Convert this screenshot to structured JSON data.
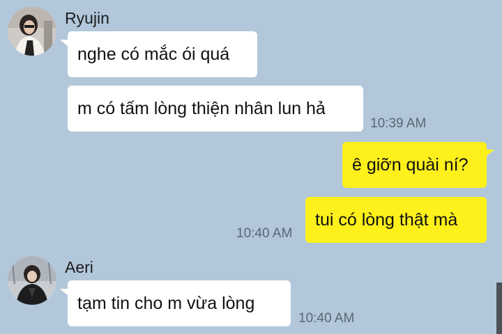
{
  "messages": [
    {
      "sender": "Ryujin",
      "text": "nghe có mắc ói quá",
      "direction": "incoming"
    },
    {
      "sender": "Ryujin",
      "text": "m có tấm lòng thiện nhân lun hả",
      "direction": "incoming",
      "time": "10:39 AM"
    },
    {
      "text": "ê giỡn quài ní?",
      "direction": "outgoing"
    },
    {
      "text": "tui có lòng thật mà",
      "direction": "outgoing",
      "time": "10:40 AM"
    },
    {
      "sender": "Aeri",
      "text": "tạm tin cho m vừa lòng",
      "direction": "incoming",
      "time": "10:40 AM"
    }
  ],
  "colors": {
    "background": "#b2c7da",
    "incoming_bubble": "#ffffff",
    "outgoing_bubble": "#fef01b",
    "timestamp": "#5a6672"
  },
  "icons": [
    "avatar-ryujin",
    "avatar-aeri"
  ]
}
